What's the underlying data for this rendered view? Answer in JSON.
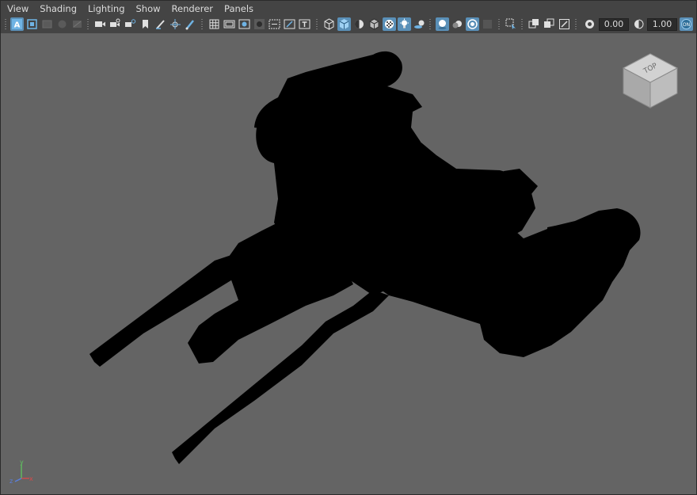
{
  "menu": {
    "items": [
      "View",
      "Shading",
      "Lighting",
      "Show",
      "Renderer",
      "Panels"
    ]
  },
  "toolbar": {
    "exposure_value": "0.00",
    "gamma_value": "1.00"
  },
  "viewport": {
    "background_color": "#646464",
    "view_cube_label": "TOP",
    "axis_labels": {
      "x": "x",
      "y": "y",
      "z": "z"
    }
  },
  "colors": {
    "accent": "#5a90b8",
    "silhouette": "#000000",
    "axis_x": "#d94a4a",
    "axis_y": "#5fc35f",
    "axis_z": "#5a7fe0"
  }
}
